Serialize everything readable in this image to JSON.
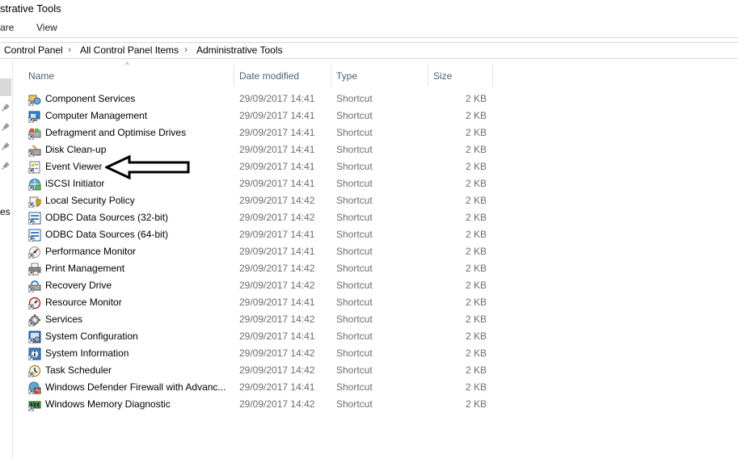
{
  "window": {
    "title": "Administrative Tools",
    "title_visible": "strative Tools"
  },
  "ribbon": {
    "tabs": [
      {
        "label": "Share",
        "visible": "are"
      },
      {
        "label": "View",
        "visible": "View"
      }
    ]
  },
  "address": {
    "breadcrumbs": [
      "Control Panel",
      "All Control Panel Items",
      "Administrative Tools"
    ],
    "separator": "›"
  },
  "navpane": {
    "partial_text": "es"
  },
  "columns": {
    "name": "Name",
    "date": "Date modified",
    "type": "Type",
    "size": "Size",
    "sort_indicator": "^"
  },
  "items": [
    {
      "name": "Component Services",
      "date": "29/09/2017 14:41",
      "type": "Shortcut",
      "size": "2 KB",
      "icon": "component-services-icon"
    },
    {
      "name": "Computer Management",
      "date": "29/09/2017 14:41",
      "type": "Shortcut",
      "size": "2 KB",
      "icon": "computer-management-icon"
    },
    {
      "name": "Defragment and Optimise Drives",
      "date": "29/09/2017 14:41",
      "type": "Shortcut",
      "size": "2 KB",
      "icon": "defragment-icon"
    },
    {
      "name": "Disk Clean-up",
      "date": "29/09/2017 14:41",
      "type": "Shortcut",
      "size": "2 KB",
      "icon": "disk-cleanup-icon"
    },
    {
      "name": "Event Viewer",
      "date": "29/09/2017 14:41",
      "type": "Shortcut",
      "size": "2 KB",
      "icon": "event-viewer-icon"
    },
    {
      "name": "iSCSI Initiator",
      "date": "29/09/2017 14:41",
      "type": "Shortcut",
      "size": "2 KB",
      "icon": "iscsi-icon"
    },
    {
      "name": "Local Security Policy",
      "date": "29/09/2017 14:42",
      "type": "Shortcut",
      "size": "2 KB",
      "icon": "security-policy-icon"
    },
    {
      "name": "ODBC Data Sources (32-bit)",
      "date": "29/09/2017 14:42",
      "type": "Shortcut",
      "size": "2 KB",
      "icon": "odbc-icon"
    },
    {
      "name": "ODBC Data Sources (64-bit)",
      "date": "29/09/2017 14:41",
      "type": "Shortcut",
      "size": "2 KB",
      "icon": "odbc-icon"
    },
    {
      "name": "Performance Monitor",
      "date": "29/09/2017 14:41",
      "type": "Shortcut",
      "size": "2 KB",
      "icon": "performance-monitor-icon"
    },
    {
      "name": "Print Management",
      "date": "29/09/2017 14:42",
      "type": "Shortcut",
      "size": "2 KB",
      "icon": "printer-icon"
    },
    {
      "name": "Recovery Drive",
      "date": "29/09/2017 14:42",
      "type": "Shortcut",
      "size": "2 KB",
      "icon": "recovery-drive-icon"
    },
    {
      "name": "Resource Monitor",
      "date": "29/09/2017 14:41",
      "type": "Shortcut",
      "size": "2 KB",
      "icon": "resource-monitor-icon"
    },
    {
      "name": "Services",
      "date": "29/09/2017 14:42",
      "type": "Shortcut",
      "size": "2 KB",
      "icon": "services-icon"
    },
    {
      "name": "System Configuration",
      "date": "29/09/2017 14:41",
      "type": "Shortcut",
      "size": "2 KB",
      "icon": "system-configuration-icon"
    },
    {
      "name": "System Information",
      "date": "29/09/2017 14:42",
      "type": "Shortcut",
      "size": "2 KB",
      "icon": "system-information-icon"
    },
    {
      "name": "Task Scheduler",
      "date": "29/09/2017 14:42",
      "type": "Shortcut",
      "size": "2 KB",
      "icon": "task-scheduler-icon"
    },
    {
      "name": "Windows Defender Firewall with Advanc...",
      "date": "29/09/2017 14:41",
      "type": "Shortcut",
      "size": "2 KB",
      "icon": "firewall-icon"
    },
    {
      "name": "Windows Memory Diagnostic",
      "date": "29/09/2017 14:42",
      "type": "Shortcut",
      "size": "2 KB",
      "icon": "memory-diagnostic-icon"
    }
  ],
  "annotation": {
    "icon": "arrow-left-icon",
    "points_to": "Event Viewer"
  },
  "colors": {
    "header_text": "#4c607a",
    "meta_text": "#6d6d6d",
    "selection": "#d9d9d9"
  }
}
